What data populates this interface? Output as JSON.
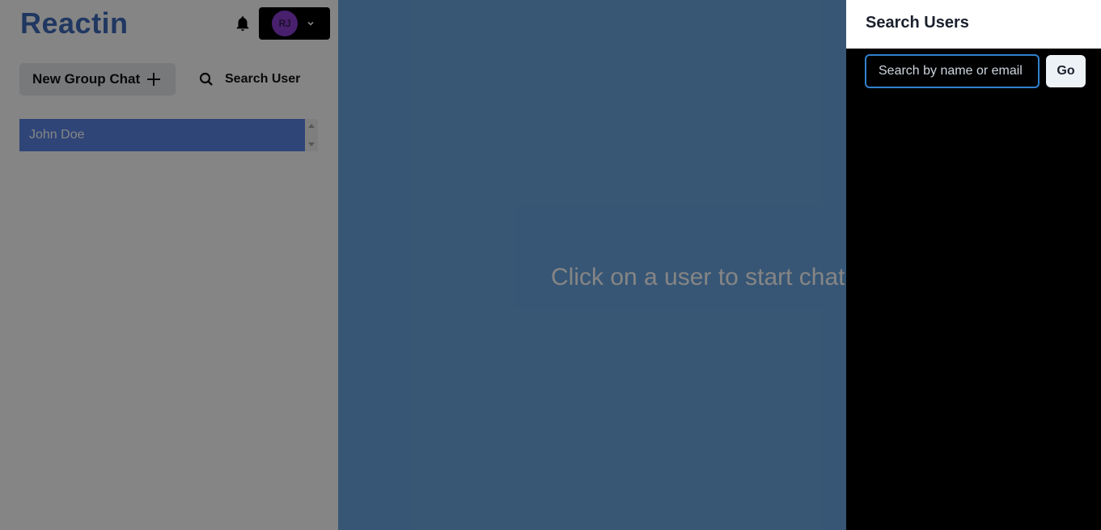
{
  "app": {
    "logo": "Reactin"
  },
  "header": {
    "avatar_initials": "RJ",
    "bell_icon": "bell-icon",
    "profile_menu_icon": "chevron-down-icon"
  },
  "sidebar": {
    "new_group_label": "New Group Chat",
    "search_user_label": "Search User",
    "chats": [
      {
        "name": "John Doe"
      }
    ]
  },
  "main": {
    "empty_state": "Click on a user to start chat"
  },
  "drawer": {
    "title": "Search Users",
    "search_placeholder": "Search by name or email",
    "go_label": "Go"
  },
  "colors": {
    "brand": "#3e6aba",
    "main_bg": "#6aa6e0",
    "chat_selected": "#5a84e6",
    "avatar": "#8a3fd1",
    "input_focus": "#3182ce"
  }
}
